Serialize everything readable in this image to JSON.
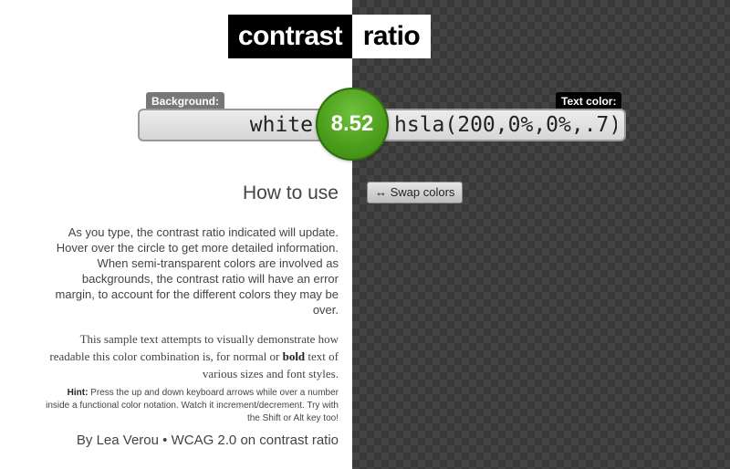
{
  "header": {
    "title_left": "contrast",
    "title_right": "ratio"
  },
  "background": {
    "label": "Background:",
    "value": "white",
    "color": "#ffffff"
  },
  "text_color": {
    "label": "Text color:",
    "value": "hsla(200,0%,0%,.7)"
  },
  "ratio": {
    "value": "8.52",
    "color": "#4c9e1c"
  },
  "swap_button": {
    "label": "↔ Swap colors"
  },
  "how_to_use": {
    "heading": "How to use",
    "paragraph": "As you type, the contrast ratio indicated will update. Hover over the circle to get more detailed information. When semi-transparent colors are involved as backgrounds, the contrast ratio will have an error margin, to account for the different colors they may be over.",
    "sample_text_part1": "This sample text attempts to visually demonstrate how readable this color combination is, for normal or ",
    "sample_text_bold": "bold",
    "sample_text_part2": " text of various sizes and font styles.",
    "hint_label": "Hint:",
    "hint_text": " Press the up and down keyboard arrows while over a number inside a functional color notation. Watch it increment/decrement. Try with the Shift or Alt key too!"
  },
  "footer": {
    "author_link": "By Lea Verou",
    "separator": " • ",
    "wcag_link": "WCAG 2.0 on contrast ratio"
  }
}
